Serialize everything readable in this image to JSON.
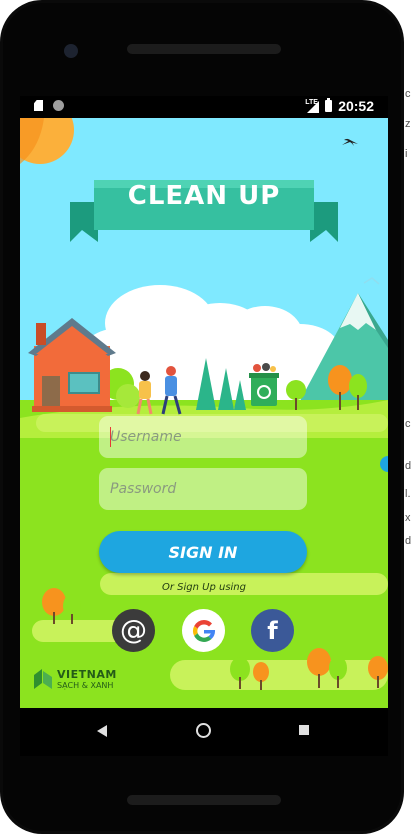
{
  "status_bar": {
    "time": "20:52",
    "network_label": "LTE"
  },
  "app": {
    "title": "CLEAN UP",
    "username_placeholder": "Username",
    "password_placeholder": "Password",
    "signin_label": "SIGN IN",
    "or_signup_text": "Or Sign Up using",
    "social": [
      {
        "name": "email",
        "glyph": "@",
        "color": "#3b3b3b"
      },
      {
        "name": "google",
        "glyph": "G",
        "color": "#ffffff"
      },
      {
        "name": "facebook",
        "glyph": "f",
        "color": "#3b5998"
      }
    ],
    "logo": {
      "line1": "VIETNAM",
      "line2": "SẠCH & XANH"
    }
  },
  "navigation": [
    "back-icon",
    "home-icon",
    "recents-icon"
  ],
  "colors": {
    "sky": "#7fe9ff",
    "grass": "#8ce31f",
    "banner": "#36c0a0",
    "signin_button": "#1ea6e0",
    "email_button": "#3b3b3b",
    "facebook_button": "#3b5998"
  }
}
